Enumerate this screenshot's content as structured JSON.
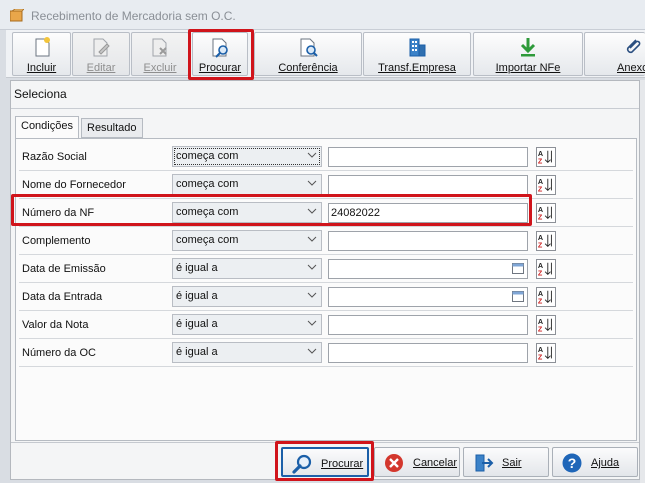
{
  "window": {
    "title": "Recebimento de Mercadoria sem O.C."
  },
  "toolbar": {
    "buttons": [
      {
        "label": "Incluir",
        "icon": "new-document-icon",
        "enabled": true
      },
      {
        "label": "Editar",
        "icon": "edit-icon",
        "enabled": false
      },
      {
        "label": "Excluir",
        "icon": "delete-document-icon",
        "enabled": false
      },
      {
        "label": "Procurar",
        "icon": "search-document-icon",
        "enabled": true
      },
      {
        "label": "Conferência",
        "icon": "check-document-icon",
        "enabled": true
      },
      {
        "label": "Transf.Empresa",
        "icon": "building-icon",
        "enabled": true
      },
      {
        "label": "Importar NFe",
        "icon": "download-arrow-icon",
        "enabled": true
      },
      {
        "label": "Anexo",
        "icon": "paperclip-icon",
        "enabled": true
      }
    ]
  },
  "panel": {
    "title": "Seleciona"
  },
  "tabs": [
    {
      "label": "Condições",
      "active": true
    },
    {
      "label": "Resultado",
      "active": false
    }
  ],
  "criteria": [
    {
      "label": "Razão Social",
      "operator": "começa com",
      "value": "",
      "date": false
    },
    {
      "label": "Nome do Fornecedor",
      "operator": "começa com",
      "value": "",
      "date": false
    },
    {
      "label": "Número da NF",
      "operator": "começa com",
      "value": "24082022",
      "date": false
    },
    {
      "label": "Complemento",
      "operator": "começa com",
      "value": "",
      "date": false
    },
    {
      "label": "Data de Emissão",
      "operator": "é igual a",
      "value": "",
      "date": true
    },
    {
      "label": "Data da Entrada",
      "operator": "é igual a",
      "value": "",
      "date": true
    },
    {
      "label": "Valor da Nota",
      "operator": "é igual a",
      "value": "",
      "date": false
    },
    {
      "label": "Número da OC",
      "operator": "é igual a",
      "value": "",
      "date": false
    }
  ],
  "actions": {
    "search": "Procurar",
    "cancel": "Cancelar",
    "exit": "Sair",
    "help": "Ajuda"
  },
  "colors": {
    "highlight": "#d0141b",
    "accent_blue": "#1b5fa8",
    "cancel_red": "#d3372d",
    "help_blue": "#1f66b8",
    "import_green": "#2e9a3a"
  }
}
